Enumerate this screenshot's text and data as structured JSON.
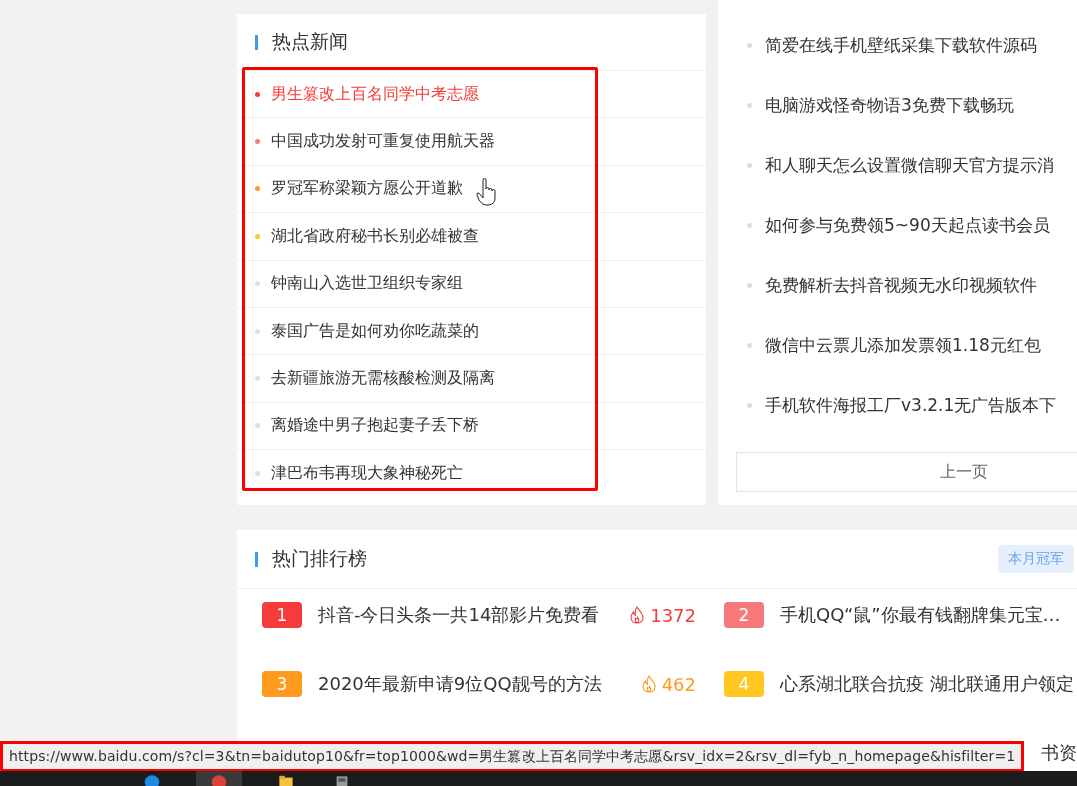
{
  "hot_news": {
    "title": "热点新闻",
    "items": [
      {
        "text": "男生篡改上百名同学中考志愿",
        "color": "#f53b3b",
        "active": true
      },
      {
        "text": "中国成功发射可重复使用航天器",
        "color": "#f77a7a",
        "active": false
      },
      {
        "text": "罗冠军称梁颖方愿公开道歉",
        "color": "#ff9a1f",
        "active": false
      },
      {
        "text": "湖北省政府秘书长别必雄被查",
        "color": "#ffc71f",
        "active": false
      },
      {
        "text": "钟南山入选世卫组织专家组",
        "color": "#dddddd",
        "active": false
      },
      {
        "text": "泰国广告是如何劝你吃蔬菜的",
        "color": "#dddddd",
        "active": false
      },
      {
        "text": "去新疆旅游无需核酸检测及隔离",
        "color": "#dddddd",
        "active": false
      },
      {
        "text": "离婚途中男子抱起妻子丢下桥",
        "color": "#dddddd",
        "active": false
      },
      {
        "text": "津巴布韦再现大象神秘死亡",
        "color": "#dddddd",
        "active": false
      }
    ]
  },
  "side_list": {
    "items": [
      "简爱在线手机壁纸采集下载软件源码",
      "电脑游戏怪奇物语3免费下载畅玩",
      "和人聊天怎么设置微信聊天官方提示消",
      "如何参与免费领5~90天起点读书会员",
      "免费解析去抖音视频无水印视频软件",
      "微信中云票儿添加发票领1.18元红包",
      "手机软件海报工厂v3.2.1无广告版本下"
    ],
    "prev_button": "上一页"
  },
  "ranking": {
    "title": "热门排行榜",
    "badge": "本月冠军",
    "rows": [
      {
        "rank": "1",
        "title": "抖音-今日头条一共14部影片免费看",
        "color": "#f53b3b",
        "heat": "1372"
      },
      {
        "rank": "2",
        "title": "手机QQ“鼠”你最有钱翻牌集元宝…",
        "color": "#f77a7a"
      },
      {
        "rank": "3",
        "title": "2020年最新申请9位QQ靓号的方法",
        "color": "#ff9a1f",
        "heat": "462"
      },
      {
        "rank": "4",
        "title": "心系湖北联合抗疫 湖北联通用户领定",
        "color": "#ffc71f"
      }
    ],
    "hidden_row_tail": "书资"
  },
  "status_bar": {
    "url": "https://www.baidu.com/s?cl=3&tn=baidutop10&fr=top1000&wd=男生篡改上百名同学中考志愿&rsv_idx=2&rsv_dl=fyb_n_homepage&hisfilter=1"
  }
}
